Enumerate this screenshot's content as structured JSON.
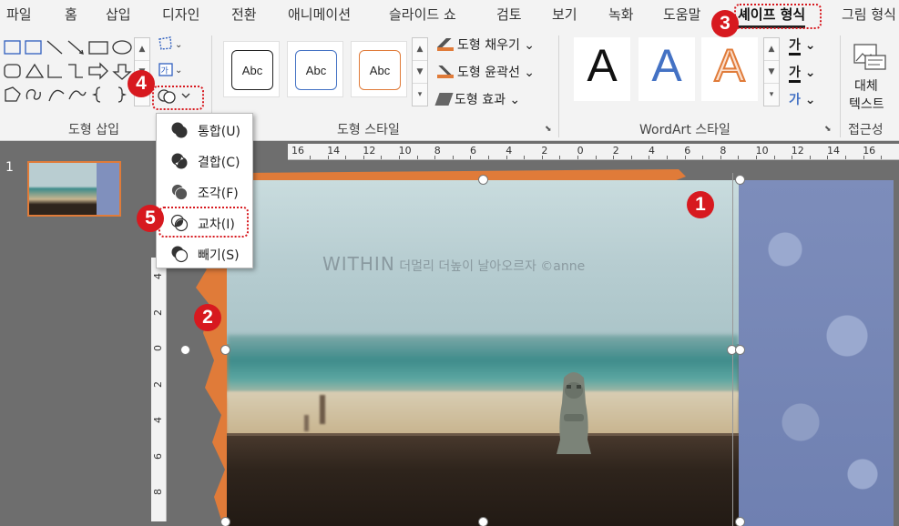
{
  "tabs": [
    "파일",
    "홈",
    "삽입",
    "디자인",
    "전환",
    "애니메이션",
    "슬라이드 쇼",
    "검토",
    "보기",
    "녹화",
    "도움말",
    "셰이프 형식",
    "그림 형식"
  ],
  "active_tab": "셰이프 형식",
  "ribbon": {
    "group_insert_shapes": "도형 삽입",
    "group_shape_styles": "도형 스타일",
    "group_wordart_styles": "WordArt 스타일",
    "group_accessibility": "접근성",
    "style_sample_text": "Abc",
    "shape_fill": "도형 채우기",
    "shape_outline": "도형 윤곽선",
    "shape_effects": "도형 효과",
    "wordart_letter": "A",
    "text_fill_glyph": "가",
    "text_outline_glyph": "가",
    "text_effects_glyph": "가",
    "alt_text_line1": "대체",
    "alt_text_line2": "텍스트",
    "text_box_glyph": "가"
  },
  "merge_menu": {
    "items": [
      {
        "label": "통합(U)",
        "icon": "union-icon"
      },
      {
        "label": "결합(C)",
        "icon": "combine-icon"
      },
      {
        "label": "조각(F)",
        "icon": "fragment-icon"
      },
      {
        "label": "교차(I)",
        "icon": "intersect-icon"
      },
      {
        "label": "빼기(S)",
        "icon": "subtract-icon"
      }
    ]
  },
  "slide_pane": {
    "slide_number": "1"
  },
  "ruler": {
    "horizontal": [
      "16",
      "14",
      "12",
      "10",
      "8",
      "6",
      "4",
      "2",
      "0",
      "2",
      "4",
      "6",
      "8",
      "10",
      "12",
      "14",
      "16"
    ],
    "vertical": [
      "4",
      "2",
      "0",
      "2",
      "4",
      "6",
      "8"
    ]
  },
  "watermark": {
    "brand": "WITHIN",
    "text": "더멀리 더높이 날아오르자 ©anne"
  },
  "callouts": [
    "1",
    "2",
    "3",
    "4",
    "5"
  ],
  "colors": {
    "accent_orange": "#e07b39",
    "callout_red": "#d7191f",
    "wordart_blue": "#4472c4"
  }
}
